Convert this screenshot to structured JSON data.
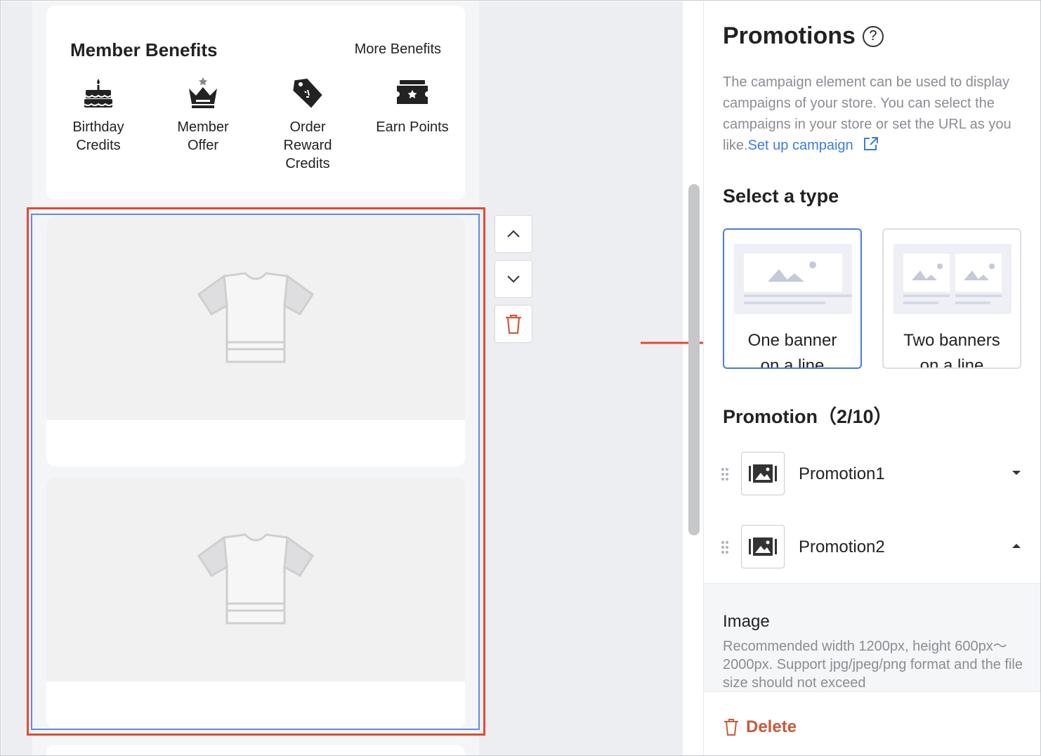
{
  "benefits": {
    "title": "Member Benefits",
    "more": "More Benefits",
    "items": [
      {
        "label_1": "Birthday",
        "label_2": "Credits",
        "icon": "birthday-cake-icon"
      },
      {
        "label_1": "Member",
        "label_2": "Offer",
        "icon": "crown-icon"
      },
      {
        "label_1": "Order",
        "label_2": "Reward",
        "label_3": "Credits",
        "icon": "price-tag-icon"
      },
      {
        "label_1": "Earn Points",
        "icon": "ticket-star-icon"
      }
    ]
  },
  "panel": {
    "title": "Promotions",
    "help_icon": "?",
    "description": "The campaign element can be used to display campaigns of your store. You can select the campaigns in your store or set the URL as you like.",
    "setup_link": "Set up campaign",
    "select_type_title": "Select a type",
    "types": [
      {
        "line_1": "One banner",
        "line_2": "on a line",
        "selected": true
      },
      {
        "line_1": "Two banners",
        "line_2": "on a line",
        "selected": false
      }
    ],
    "promotion_title": "Promotion（2/10）",
    "promotions": [
      {
        "name": "Promotion1",
        "expanded": false
      },
      {
        "name": "Promotion2",
        "expanded": true
      }
    ],
    "image_title": "Image",
    "image_desc": "Recommended width 1200px, height 600px～2000px. Support jpg/jpeg/png format and the file size should not exceed",
    "delete_label": "Delete"
  },
  "colors": {
    "accent_blue": "#4b7cd8",
    "selection_red": "#e24a35",
    "delete_red": "#c85a3c",
    "link_blue": "#3d7be0"
  }
}
